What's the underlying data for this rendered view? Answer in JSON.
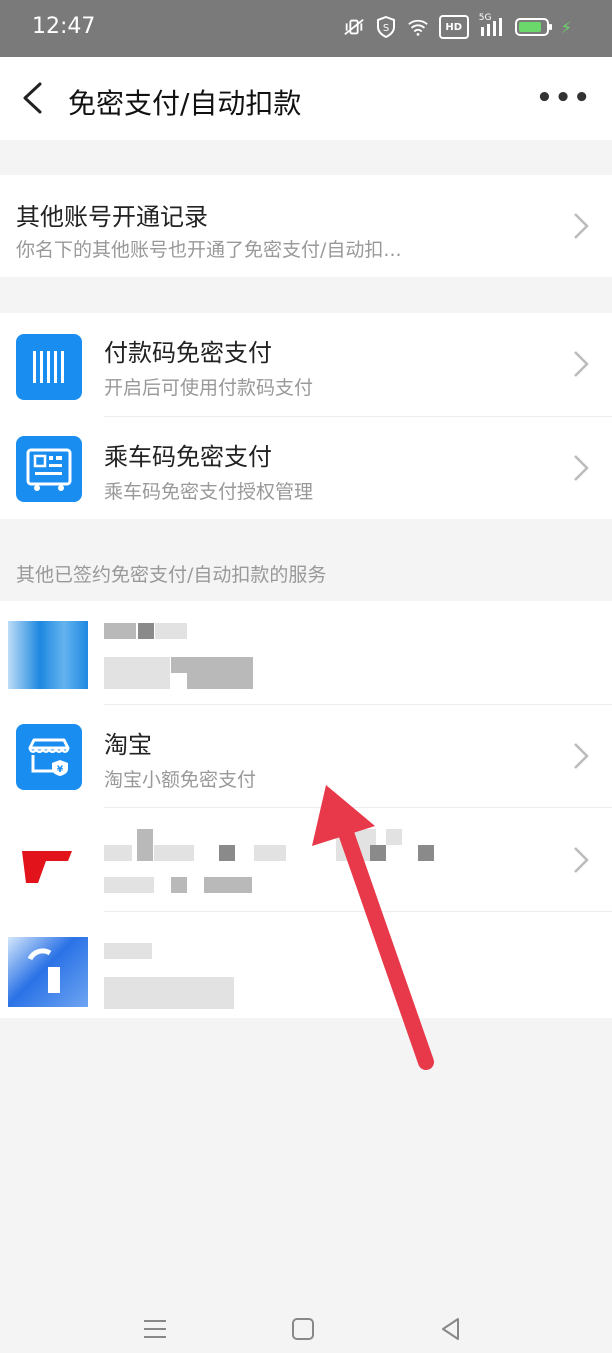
{
  "status": {
    "time": "12:47",
    "icons": [
      "mute-vibrate-icon",
      "shield-icon",
      "wifi-icon",
      "hd-icon",
      "signal-5g-icon",
      "battery-icon"
    ],
    "hd_label": "HD",
    "network_label": "5G"
  },
  "header": {
    "title": "免密支付/自动扣款"
  },
  "record": {
    "title": "其他账号开通记录",
    "subtitle": "你名下的其他账号也开通了免密支付/自动扣..."
  },
  "features": [
    {
      "title": "付款码免密支付",
      "subtitle": "开启后可使用付款码支付",
      "icon": "barcode-icon"
    },
    {
      "title": "乘车码免密支付",
      "subtitle": "乘车码免密支付授权管理",
      "icon": "bus-qr-icon"
    }
  ],
  "services_label": "其他已签约免密支付/自动扣款的服务",
  "services": [
    {
      "title": "",
      "subtitle": "",
      "icon": "blurred-app-icon"
    },
    {
      "title": "淘宝",
      "subtitle": "淘宝小额免密支付",
      "icon": "taobao-shop-icon"
    },
    {
      "title": "",
      "subtitle": "",
      "icon": "blurred-app-icon"
    },
    {
      "title": "",
      "subtitle": "",
      "icon": "blurred-app-icon"
    }
  ],
  "colors": {
    "accent_blue": "#1a8ef0",
    "annotation_arrow": "#e8394a",
    "statusbar": "#7a7a7a"
  }
}
